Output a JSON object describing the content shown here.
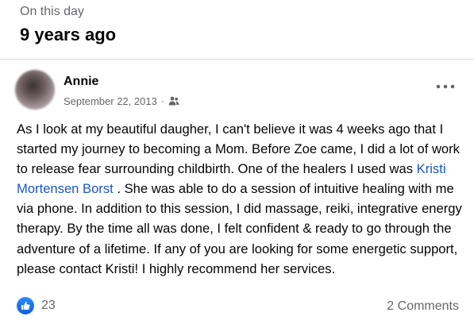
{
  "memory": {
    "label": "On this day",
    "title": "9 years ago"
  },
  "post": {
    "author": "Annie",
    "date": "September 22, 2013",
    "separator": "·",
    "audience_icon": "friends-icon",
    "text_before_mention": "As I look at my beautiful daugher, I can't believe it was 4 weeks ago that I started my journey to becoming a Mom. Before Zoe came, I did a lot of work to release fear surrounding childbirth. One of the healers I used was ",
    "mention": "Kristi Mortensen Borst",
    "text_after_mention": " . She was able to do a session of intuitive healing with me via phone. In addition to this session, I did massage, reiki, integrative energy therapy. By the time all was done, I felt confident & ready to go through the adventure of a lifetime. If any of you are looking for some energetic support, please contact Kristi! I highly recommend her services.",
    "reaction_count": "23",
    "comments_label": "2 Comments"
  },
  "colors": {
    "accent": "#1a56c9",
    "like_blue": "#1877f2",
    "secondary_text": "#65676b"
  }
}
